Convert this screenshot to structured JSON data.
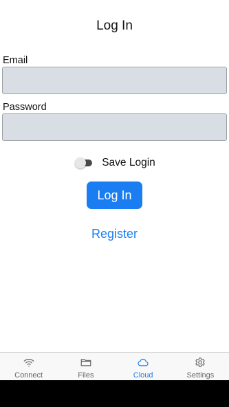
{
  "header": {
    "title": "Log In"
  },
  "form": {
    "email_label": "Email",
    "email_value": "",
    "password_label": "Password",
    "password_value": "",
    "save_login_label": "Save Login",
    "save_login_checked": false,
    "login_button_label": "Log In",
    "register_link_label": "Register"
  },
  "tabbar": {
    "active_tab": "Cloud",
    "tabs": [
      {
        "label": "Connect",
        "icon": "wifi-icon"
      },
      {
        "label": "Files",
        "icon": "folder-icon"
      },
      {
        "label": "Cloud",
        "icon": "cloud-icon"
      },
      {
        "label": "Settings",
        "icon": "gear-icon"
      }
    ]
  },
  "colors": {
    "accent": "#1a7ef2",
    "input_background": "#d9dee4",
    "inactive_tab": "#666666"
  }
}
